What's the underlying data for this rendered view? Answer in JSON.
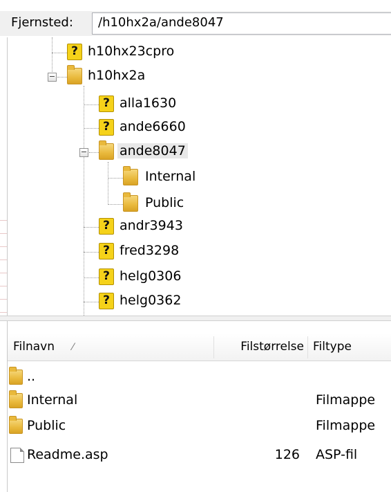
{
  "sitebar": {
    "label": "Fjernsted:",
    "path": "/h10hx2a/ande8047"
  },
  "tree": {
    "nodes": [
      {
        "name": "h10hx23cpro",
        "icon": "question-icon"
      },
      {
        "name": "h10hx2a",
        "icon": "folder-icon",
        "expanded": true
      },
      {
        "name": "alla1630",
        "icon": "question-icon"
      },
      {
        "name": "ande6660",
        "icon": "question-icon"
      },
      {
        "name": "ande8047",
        "icon": "folder-icon",
        "expanded": true,
        "selected": true
      },
      {
        "name": "Internal",
        "icon": "folder-icon"
      },
      {
        "name": "Public",
        "icon": "folder-icon"
      },
      {
        "name": "andr3943",
        "icon": "question-icon"
      },
      {
        "name": "fred3298",
        "icon": "question-icon"
      },
      {
        "name": "helg0306",
        "icon": "question-icon"
      },
      {
        "name": "helg0362",
        "icon": "question-icon"
      }
    ],
    "collapse_symbol": "−"
  },
  "list": {
    "columns": {
      "name": "Filnavn",
      "sort_indicator": "⁄",
      "size": "Filstørrelse",
      "type": "Filtype"
    },
    "rows": [
      {
        "name": "..",
        "size": "",
        "type": "",
        "icon": "folder-icon"
      },
      {
        "name": "Internal",
        "size": "",
        "type": "Filmappe",
        "icon": "folder-icon"
      },
      {
        "name": "Public",
        "size": "",
        "type": "Filmappe",
        "icon": "folder-icon"
      },
      {
        "name": "Readme.asp",
        "size": "126",
        "type": "ASP-fil",
        "icon": "file-icon"
      }
    ]
  },
  "colors": {
    "folder": "#e9b93c",
    "question": "#f5d21a",
    "selection": "#e8e8e8"
  }
}
